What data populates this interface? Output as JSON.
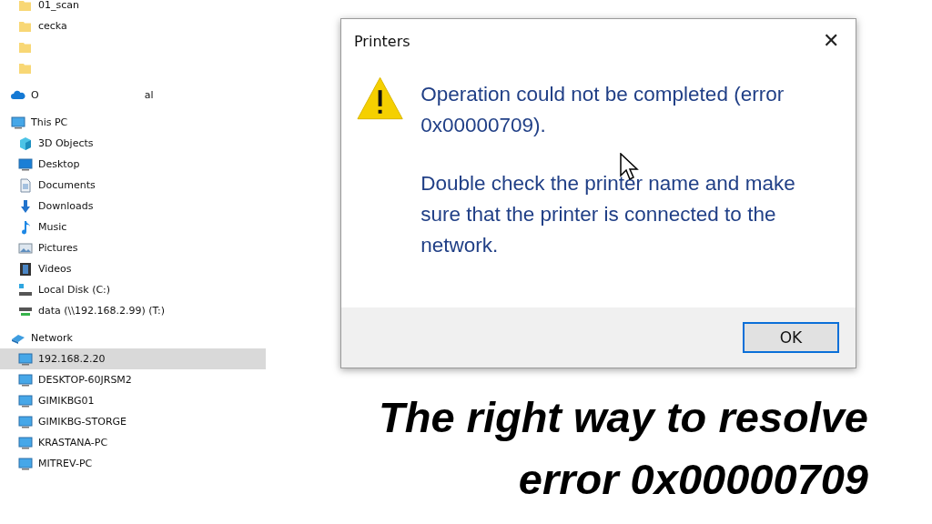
{
  "sidebar": {
    "items": [
      {
        "kind": "folder",
        "label": "01_scan",
        "selected": false
      },
      {
        "kind": "folder",
        "label": "cecka",
        "selected": false
      },
      {
        "kind": "folder",
        "selected": false
      },
      {
        "kind": "folder",
        "selected": false
      },
      {
        "kind": "cloud",
        "label_parts": [
          "O",
          "al"
        ],
        "selected": false
      },
      {
        "kind": "pc",
        "label": "This PC",
        "selected": false,
        "children": [
          {
            "kind": "cube",
            "label": "3D Objects",
            "selected": false
          },
          {
            "kind": "desktop",
            "label": "Desktop",
            "selected": false
          },
          {
            "kind": "document",
            "label": "Documents",
            "selected": false
          },
          {
            "kind": "download",
            "label": "Downloads",
            "selected": false
          },
          {
            "kind": "music",
            "label": "Music",
            "selected": false
          },
          {
            "kind": "pictures",
            "label": "Pictures",
            "selected": false
          },
          {
            "kind": "videos",
            "label": "Videos",
            "selected": false
          },
          {
            "kind": "disk",
            "label": "Local Disk (C:)",
            "selected": false
          },
          {
            "kind": "netdrive",
            "label": "data (\\\\192.168.2.99) (T:)",
            "selected": false
          }
        ]
      },
      {
        "kind": "network",
        "label": "Network",
        "selected": false,
        "children": [
          {
            "kind": "computer",
            "label": "192.168.2.20",
            "selected": true
          },
          {
            "kind": "computer",
            "label": "DESKTOP-60JRSM2",
            "selected": false
          },
          {
            "kind": "computer",
            "label": "GIMIKBG01",
            "selected": false
          },
          {
            "kind": "computer",
            "label": "GIMIKBG-STORGE",
            "selected": false
          },
          {
            "kind": "computer",
            "label": "KRASTANA-PC",
            "selected": false
          },
          {
            "kind": "computer",
            "label": "MITREV-PC",
            "selected": false
          }
        ]
      }
    ]
  },
  "dialog": {
    "title": "Printers",
    "close": "✕",
    "messages": [
      "Operation could not be completed (error 0x00000709).",
      "Double check the printer name and make sure that the printer is connected to the network."
    ],
    "buttons": [
      "OK"
    ]
  },
  "headline": "The right way to resolve error 0x00000709"
}
